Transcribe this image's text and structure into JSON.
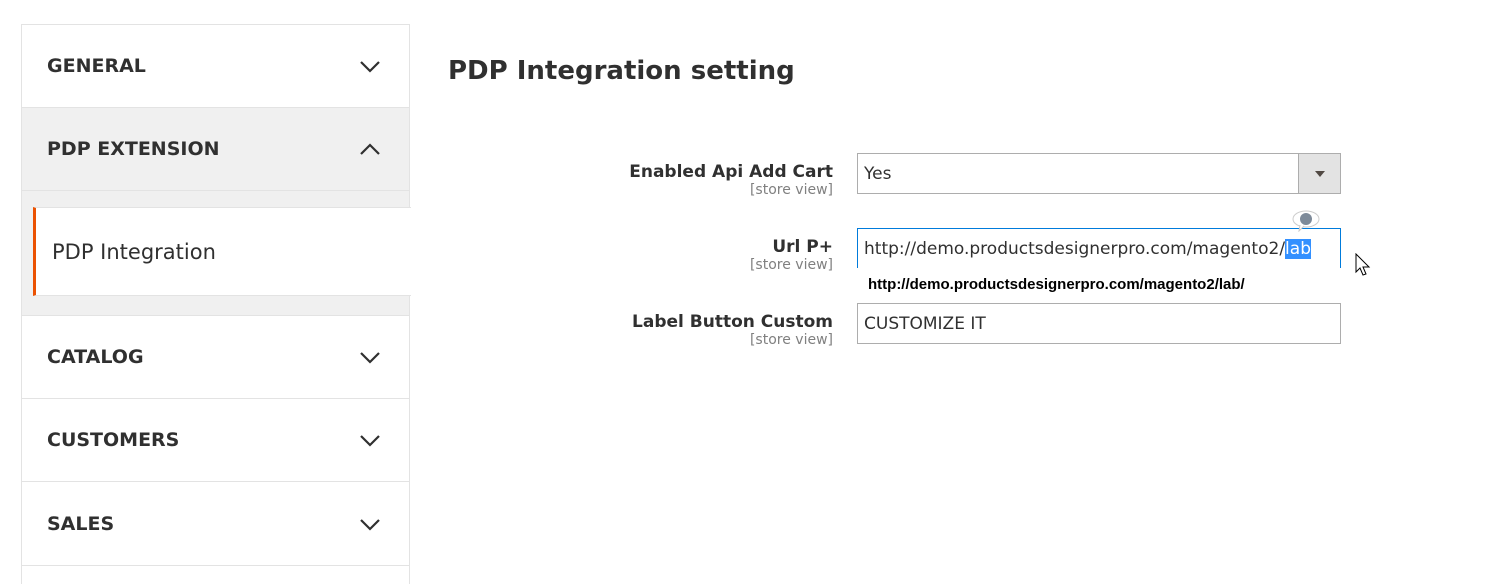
{
  "sidebar": {
    "sections": [
      {
        "label": "GENERAL",
        "expanded": false
      },
      {
        "label": "PDP EXTENSION",
        "expanded": true,
        "items": [
          {
            "label": "PDP Integration",
            "active": true
          }
        ]
      },
      {
        "label": "CATALOG",
        "expanded": false
      },
      {
        "label": "CUSTOMERS",
        "expanded": false
      },
      {
        "label": "SALES",
        "expanded": false
      }
    ]
  },
  "main": {
    "title": "PDP Integration setting",
    "fields": [
      {
        "label": "Enabled Api Add Cart",
        "scope": "[store view]",
        "value": "Yes"
      },
      {
        "label": "Url P+",
        "scope": "[store view]",
        "value_prefix": "http://demo.productsdesignerpro.com/magento2/",
        "value_selected": "lab",
        "autocomplete": "http://demo.productsdesignerpro.com/magento2/lab/"
      },
      {
        "label": "Label Button Custom",
        "scope": "[store view]",
        "value": "CUSTOMIZE IT"
      }
    ]
  },
  "colors": {
    "accent": "#eb5202",
    "focus": "#007bdb",
    "selection": "#3390ff"
  }
}
